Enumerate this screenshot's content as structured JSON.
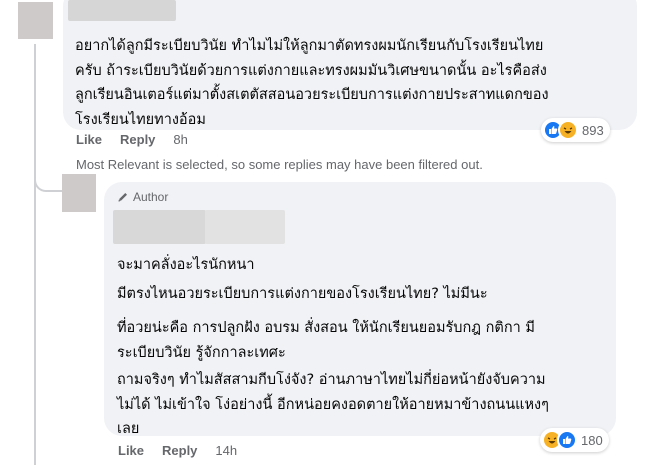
{
  "top_comment": {
    "lines": [
      "อยากได้ลูกมีระเบียบวินัย ทำไมไม่ให้ลูกมาตัดทรงผมนักเรียนกับโรงเรียนไทย",
      "ครับ ถ้าระเบียบวินัยด้วยการแต่งกายและทรงผมมันวิเศษขนาดนั้น อะไรคือส่ง",
      "ลูกเรียนอินเตอร์แต่มาตั้งสเตตัสสอนอวยระเบียบการแต่งกายประสาทแดกของ",
      "โรงเรียนไทยทางอ้อม"
    ],
    "like_label": "Like",
    "reply_label": "Reply",
    "time": "8h",
    "reaction_count": "893",
    "reaction_icons": [
      "like-icon",
      "haha-icon"
    ]
  },
  "filter_note": "Most Relevant is selected, so some replies may have been filtered out.",
  "reply": {
    "author_badge": "Author",
    "paragraphs": [
      [
        "จะมาคลั่งอะไรนักหนา"
      ],
      [
        "มีตรงไหนอวยระเบียบการแต่งกายของโรงเรียนไทย? ไม่มีนะ"
      ],
      [
        "ที่อวยน่ะคือ การปลูกฝัง อบรม สั่งสอน ให้นักเรียนยอมรับกฎ กติกา มี",
        "ระเบียบวินัย รู้จักกาละเทศะ"
      ],
      [
        "ถามจริงๆ ทำไมสัสสามกีบโง่จัง? อ่านภาษาไทยไม่กี่ย่อหน้ายังจับความ",
        "ไม่ได้ ไม่เข้าใจ โง่อย่างนี้ อีกหน่อยคงอดตายให้อายหมาข้างถนนแหงๆ",
        "เลย"
      ]
    ],
    "like_label": "Like",
    "reply_label": "Reply",
    "time": "14h",
    "reaction_count": "180",
    "reaction_icons": [
      "haha-icon",
      "like-icon"
    ]
  },
  "colors": {
    "bubble": "#f0f2f5",
    "secondary_text": "#65676b",
    "like_blue": "#1877f2",
    "haha_yellow": "#f7b125"
  }
}
